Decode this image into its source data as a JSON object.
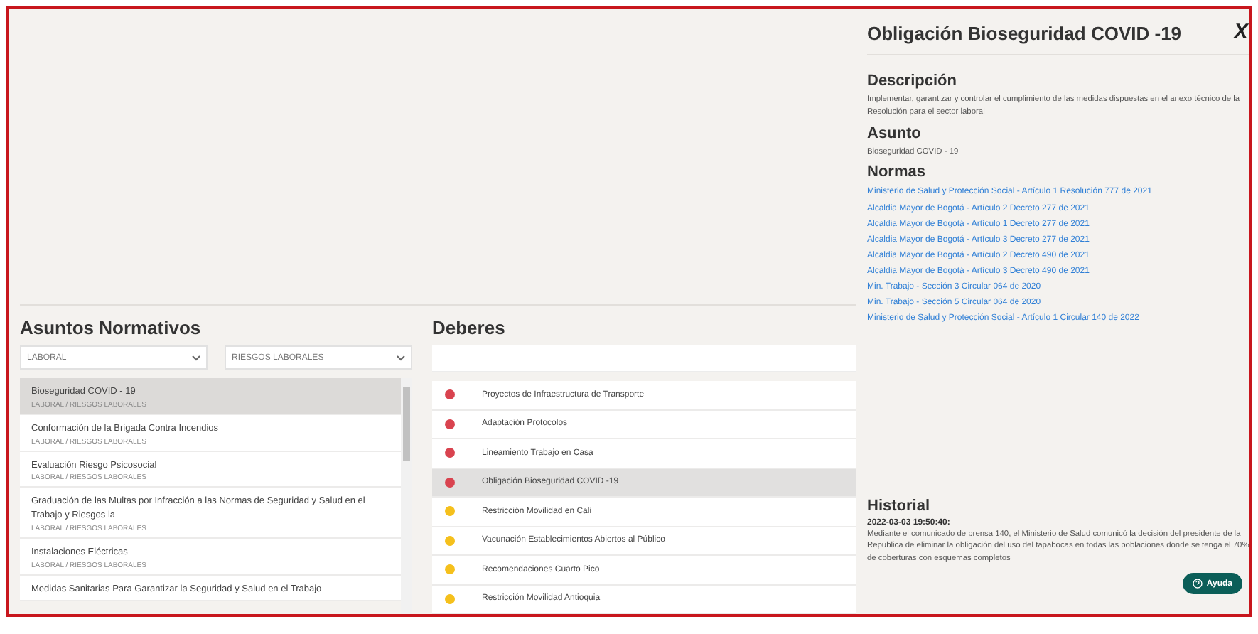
{
  "asuntos": {
    "title": "Asuntos Normativos",
    "filters": [
      {
        "value": "LABORAL"
      },
      {
        "value": "RIESGOS LABORALES"
      }
    ],
    "items": [
      {
        "title": "Bioseguridad COVID - 19",
        "subtitle": "LABORAL / RIESGOS LABORALES",
        "selected": true
      },
      {
        "title": "Conformación de la Brigada Contra Incendios",
        "subtitle": "LABORAL / RIESGOS LABORALES",
        "selected": false
      },
      {
        "title": "Evaluación Riesgo Psicosocial",
        "subtitle": "LABORAL / RIESGOS LABORALES",
        "selected": false
      },
      {
        "title": "Graduación de las Multas por Infracción a las Normas de Seguridad y Salud en el Trabajo y Riesgos la",
        "subtitle": "LABORAL / RIESGOS LABORALES",
        "selected": false
      },
      {
        "title": "Instalaciones Eléctricas",
        "subtitle": "LABORAL / RIESGOS LABORALES",
        "selected": false
      },
      {
        "title": "Medidas Sanitarias Para Garantizar la Seguridad y Salud en el Trabajo",
        "selected": false
      }
    ]
  },
  "deberes": {
    "title": "Deberes",
    "items": [
      {
        "label": "Proyectos de Infraestructura de Transporte",
        "color": "#d9434f",
        "selected": false
      },
      {
        "label": "Adaptación Protocolos",
        "color": "#d9434f",
        "selected": false
      },
      {
        "label": "Lineamiento Trabajo en Casa",
        "color": "#d9434f",
        "selected": false
      },
      {
        "label": "Obligación Bioseguridad COVID -19",
        "color": "#d9434f",
        "selected": true
      },
      {
        "label": "Restricción Movilidad en Cali",
        "color": "#f5c01c",
        "selected": false
      },
      {
        "label": "Vacunación Establecimientos Abiertos al Público",
        "color": "#f5c01c",
        "selected": false
      },
      {
        "label": "Recomendaciones Cuarto Pico",
        "color": "#f5c01c",
        "selected": false
      },
      {
        "label": "Restricción Movilidad Antioquia",
        "color": "#f5c01c",
        "selected": false
      }
    ]
  },
  "detail": {
    "title": "Obligación Bioseguridad COVID -19",
    "close": "X",
    "descripcion": {
      "heading": "Descripción",
      "text": "Implementar, garantizar y controlar el cumplimiento de las medidas dispuestas en el anexo técnico de la Resolución para el sector laboral"
    },
    "asunto": {
      "heading": "Asunto",
      "text": "Bioseguridad COVID - 19"
    },
    "normas": {
      "heading": "Normas",
      "links": [
        "Ministerio de Salud y Protección Social - Artículo 1 Resolución 777 de 2021",
        "Alcaldia Mayor de Bogotá - Artículo 2 Decreto 277 de 2021",
        "Alcaldia Mayor de Bogotá - Artículo 1 Decreto 277 de 2021",
        "Alcaldia Mayor de Bogotá - Artículo 3 Decreto 277 de 2021",
        "Alcaldia Mayor de Bogotá - Artículo 2 Decreto 490 de 2021",
        "Alcaldia Mayor de Bogotá - Artículo 3 Decreto 490 de 2021",
        "Min. Trabajo - Sección 3 Circular 064 de 2020",
        "Min. Trabajo - Sección 5 Circular 064 de 2020",
        "Ministerio de Salud y Protección Social - Artículo 1 Circular 140 de 2022"
      ]
    },
    "historial": {
      "heading": "Historial",
      "date": "2022-03-03 19:50:40:",
      "text": "Mediante el comunicado de prensa 140, el Ministerio de Salud comunicó la decisión del presidente de la Republica de  eliminar la obligación del uso del tapabocas en todas las poblaciones donde se tenga el 70% de coberturas con esquemas completos"
    }
  },
  "help_button": {
    "label": "Ayuda"
  }
}
